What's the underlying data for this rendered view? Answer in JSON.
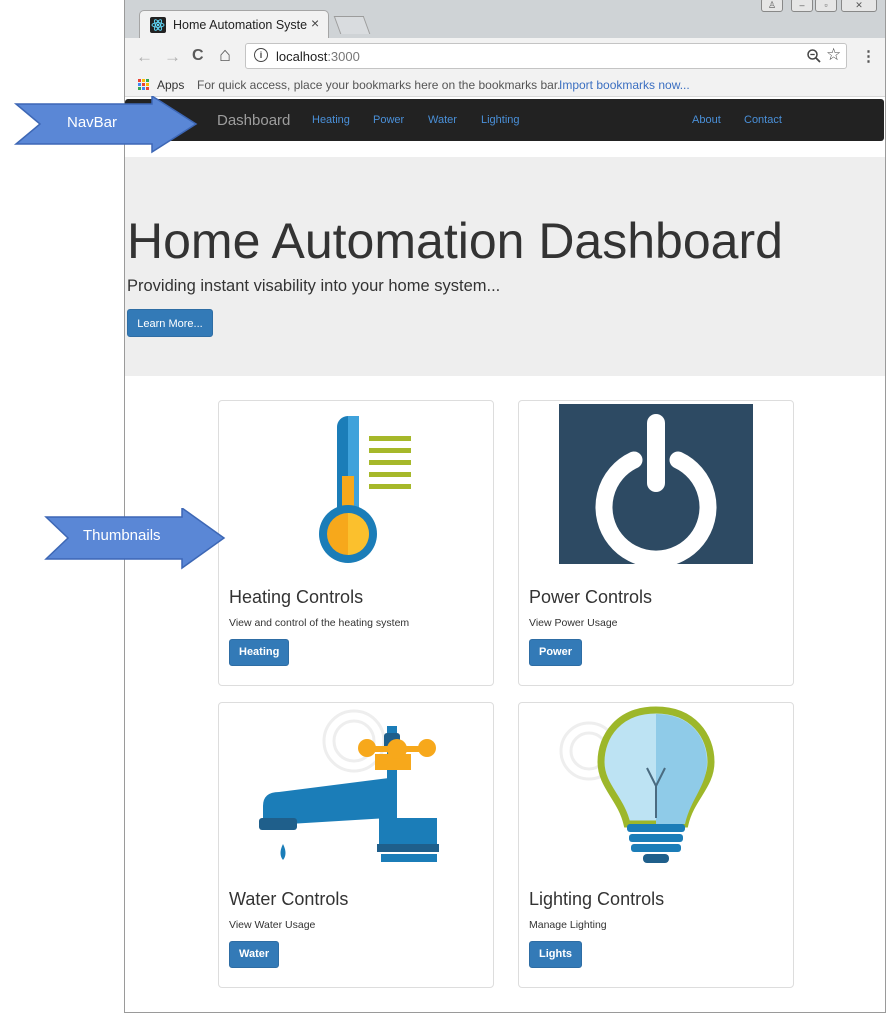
{
  "browser": {
    "tab_title": "Home Automation Syste",
    "tab_close": "×",
    "url_host": "localhost",
    "url_port": ":3000",
    "nav_back": "←",
    "nav_forward": "→",
    "nav_reload": "C",
    "nav_home": "⌂",
    "star_glyph": "☆",
    "menu_glyph": "⋮",
    "info_glyph": "i",
    "window_controls": [
      "♙",
      "–",
      "▫",
      "✕"
    ]
  },
  "bookmarks_bar": {
    "apps_label": "Apps",
    "hint": "For quick access, place your bookmarks here on the bookmarks bar.",
    "import_link": "Import bookmarks now..."
  },
  "navbar": {
    "brand": "Dashboard",
    "left_links": [
      "Heating",
      "Power",
      "Water",
      "Lighting"
    ],
    "right_links": [
      "About",
      "Contact"
    ]
  },
  "jumbotron": {
    "title": "Home Automation Dashboard",
    "subtitle": "Providing instant visability into your home system...",
    "button_label": "Learn More..."
  },
  "cards": [
    {
      "title": "Heating Controls",
      "description": "View and control of the heating system",
      "button_label": "Heating",
      "icon": "thermometer-icon"
    },
    {
      "title": "Power Controls",
      "description": "View Power Usage",
      "button_label": "Power",
      "icon": "power-icon"
    },
    {
      "title": "Water Controls",
      "description": "View Water Usage",
      "button_label": "Water",
      "icon": "water-tap-icon"
    },
    {
      "title": "Lighting Controls",
      "description": "Manage Lighting",
      "button_label": "Lights",
      "icon": "light-bulb-icon"
    }
  ],
  "callouts": {
    "navbar_arrow": "NavBar",
    "thumbnails_arrow": "Thumbnails"
  },
  "colors": {
    "navbar_bg": "#222222",
    "nav_link": "#4a90d9",
    "jumbotron_bg": "#eeeeee",
    "button_primary": "#337ab7",
    "callout_blue": "#4f7ccf"
  }
}
